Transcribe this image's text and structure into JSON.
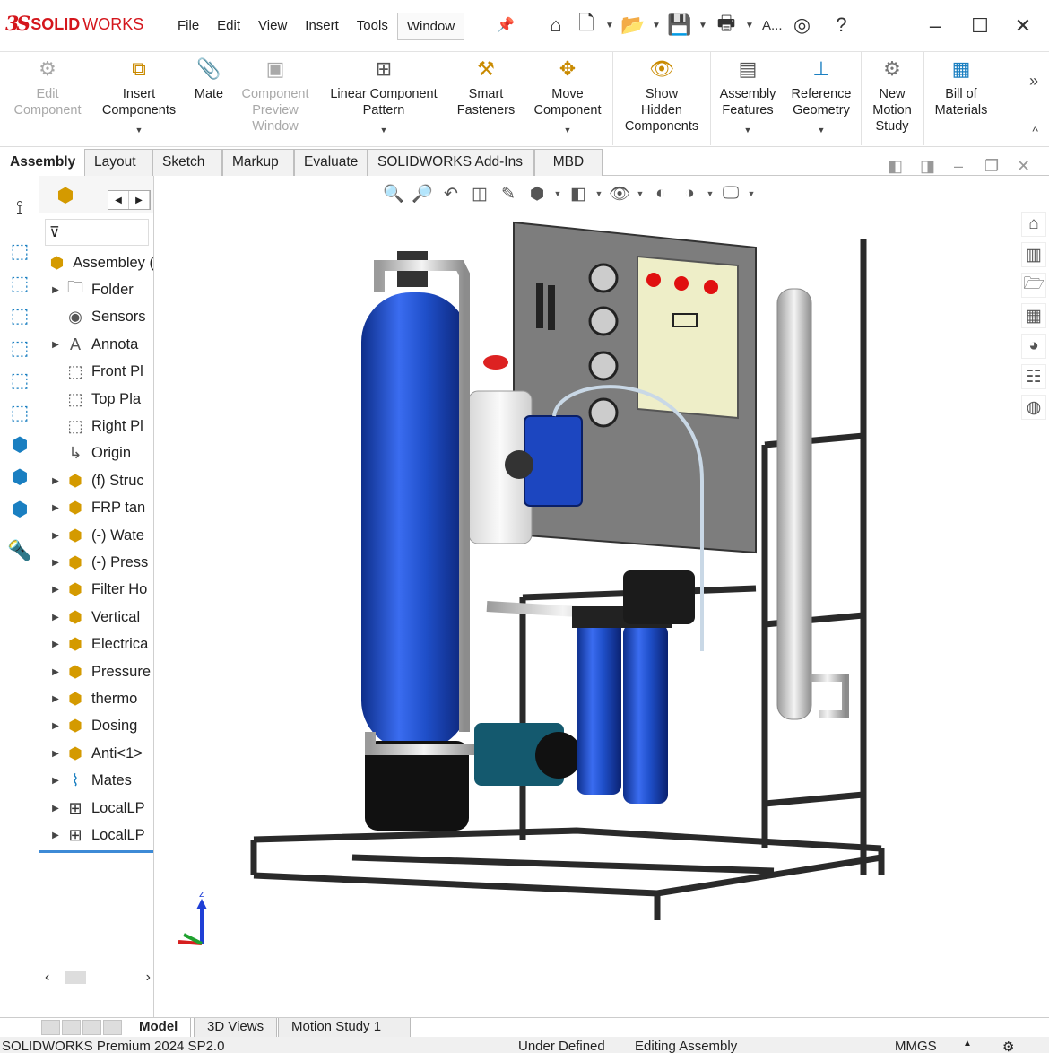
{
  "app": {
    "brand_ds": "3S",
    "brand_solid": "SOLID",
    "brand_works": "WORKS"
  },
  "menu": [
    "File",
    "Edit",
    "View",
    "Insert",
    "Tools",
    "Window"
  ],
  "quick_access": {
    "account_label": "A..."
  },
  "ribbon": {
    "buttons": [
      {
        "label": "Edit\nComponent",
        "icon": "edit-component-icon",
        "disabled": true
      },
      {
        "label": "Insert\nComponents",
        "icon": "insert-components-icon",
        "disabled": false
      },
      {
        "label": "Mate",
        "icon": "mate-icon",
        "disabled": false
      },
      {
        "label": "Component\nPreview\nWindow",
        "icon": "component-preview-icon",
        "disabled": true
      },
      {
        "label": "Linear Component\nPattern",
        "icon": "linear-pattern-icon",
        "disabled": false
      },
      {
        "label": "Smart\nFasteners",
        "icon": "smart-fasteners-icon",
        "disabled": false
      },
      {
        "label": "Move\nComponent",
        "icon": "move-component-icon",
        "disabled": false
      },
      {
        "label": "Show\nHidden\nComponents",
        "icon": "show-hidden-icon",
        "disabled": false
      },
      {
        "label": "Assembly\nFeatures",
        "icon": "assembly-features-icon",
        "disabled": false
      },
      {
        "label": "Reference\nGeometry",
        "icon": "reference-geometry-icon",
        "disabled": false
      },
      {
        "label": "New\nMotion\nStudy",
        "icon": "motion-study-icon",
        "disabled": false
      },
      {
        "label": "Bill of\nMaterials",
        "icon": "bom-icon",
        "disabled": false
      }
    ]
  },
  "tabs": [
    "Assembly",
    "Layout",
    "Sketch",
    "Markup",
    "Evaluate",
    "SOLIDWORKS Add-Ins",
    "MBD"
  ],
  "tree": {
    "items": [
      {
        "label": "Assembley (",
        "icon": "assembly-icon"
      },
      {
        "label": "Folder",
        "icon": "folder-icon"
      },
      {
        "label": "Sensors",
        "icon": "sensor-icon"
      },
      {
        "label": "Annota",
        "icon": "annotation-icon"
      },
      {
        "label": "Front Pl",
        "icon": "plane-icon"
      },
      {
        "label": "Top Pla",
        "icon": "plane-icon"
      },
      {
        "label": "Right Pl",
        "icon": "plane-icon"
      },
      {
        "label": "Origin",
        "icon": "origin-icon"
      },
      {
        "label": "(f) Struc",
        "icon": "subassembly-icon"
      },
      {
        "label": "FRP tan",
        "icon": "subassembly-icon"
      },
      {
        "label": "(-) Wate",
        "icon": "subassembly-icon"
      },
      {
        "label": "(-) Press",
        "icon": "subassembly-icon"
      },
      {
        "label": "Filter Ho",
        "icon": "subassembly-icon"
      },
      {
        "label": "Vertical",
        "icon": "subassembly-icon"
      },
      {
        "label": "Electrica",
        "icon": "subassembly-icon"
      },
      {
        "label": "Pressure",
        "icon": "subassembly-icon"
      },
      {
        "label": "thermo",
        "icon": "subassembly-icon"
      },
      {
        "label": "Dosing",
        "icon": "subassembly-icon"
      },
      {
        "label": "Anti<1>",
        "icon": "subassembly-icon"
      },
      {
        "label": "Mates",
        "icon": "mates-icon"
      },
      {
        "label": "LocalLP",
        "icon": "pattern-icon"
      },
      {
        "label": "LocalLP",
        "icon": "pattern-icon"
      }
    ]
  },
  "bottom_tabs": [
    "Model",
    "3D Views",
    "Motion Study 1"
  ],
  "status": {
    "product": "SOLIDWORKS Premium 2024 SP2.0",
    "definition": "Under Defined",
    "mode": "Editing Assembly",
    "units": "MMGS"
  },
  "triad": {
    "z": "z"
  },
  "colors": {
    "brand": "#d4161c",
    "tank_blue": "#1f4fc9",
    "panel_gray": "#7a7a7a"
  }
}
